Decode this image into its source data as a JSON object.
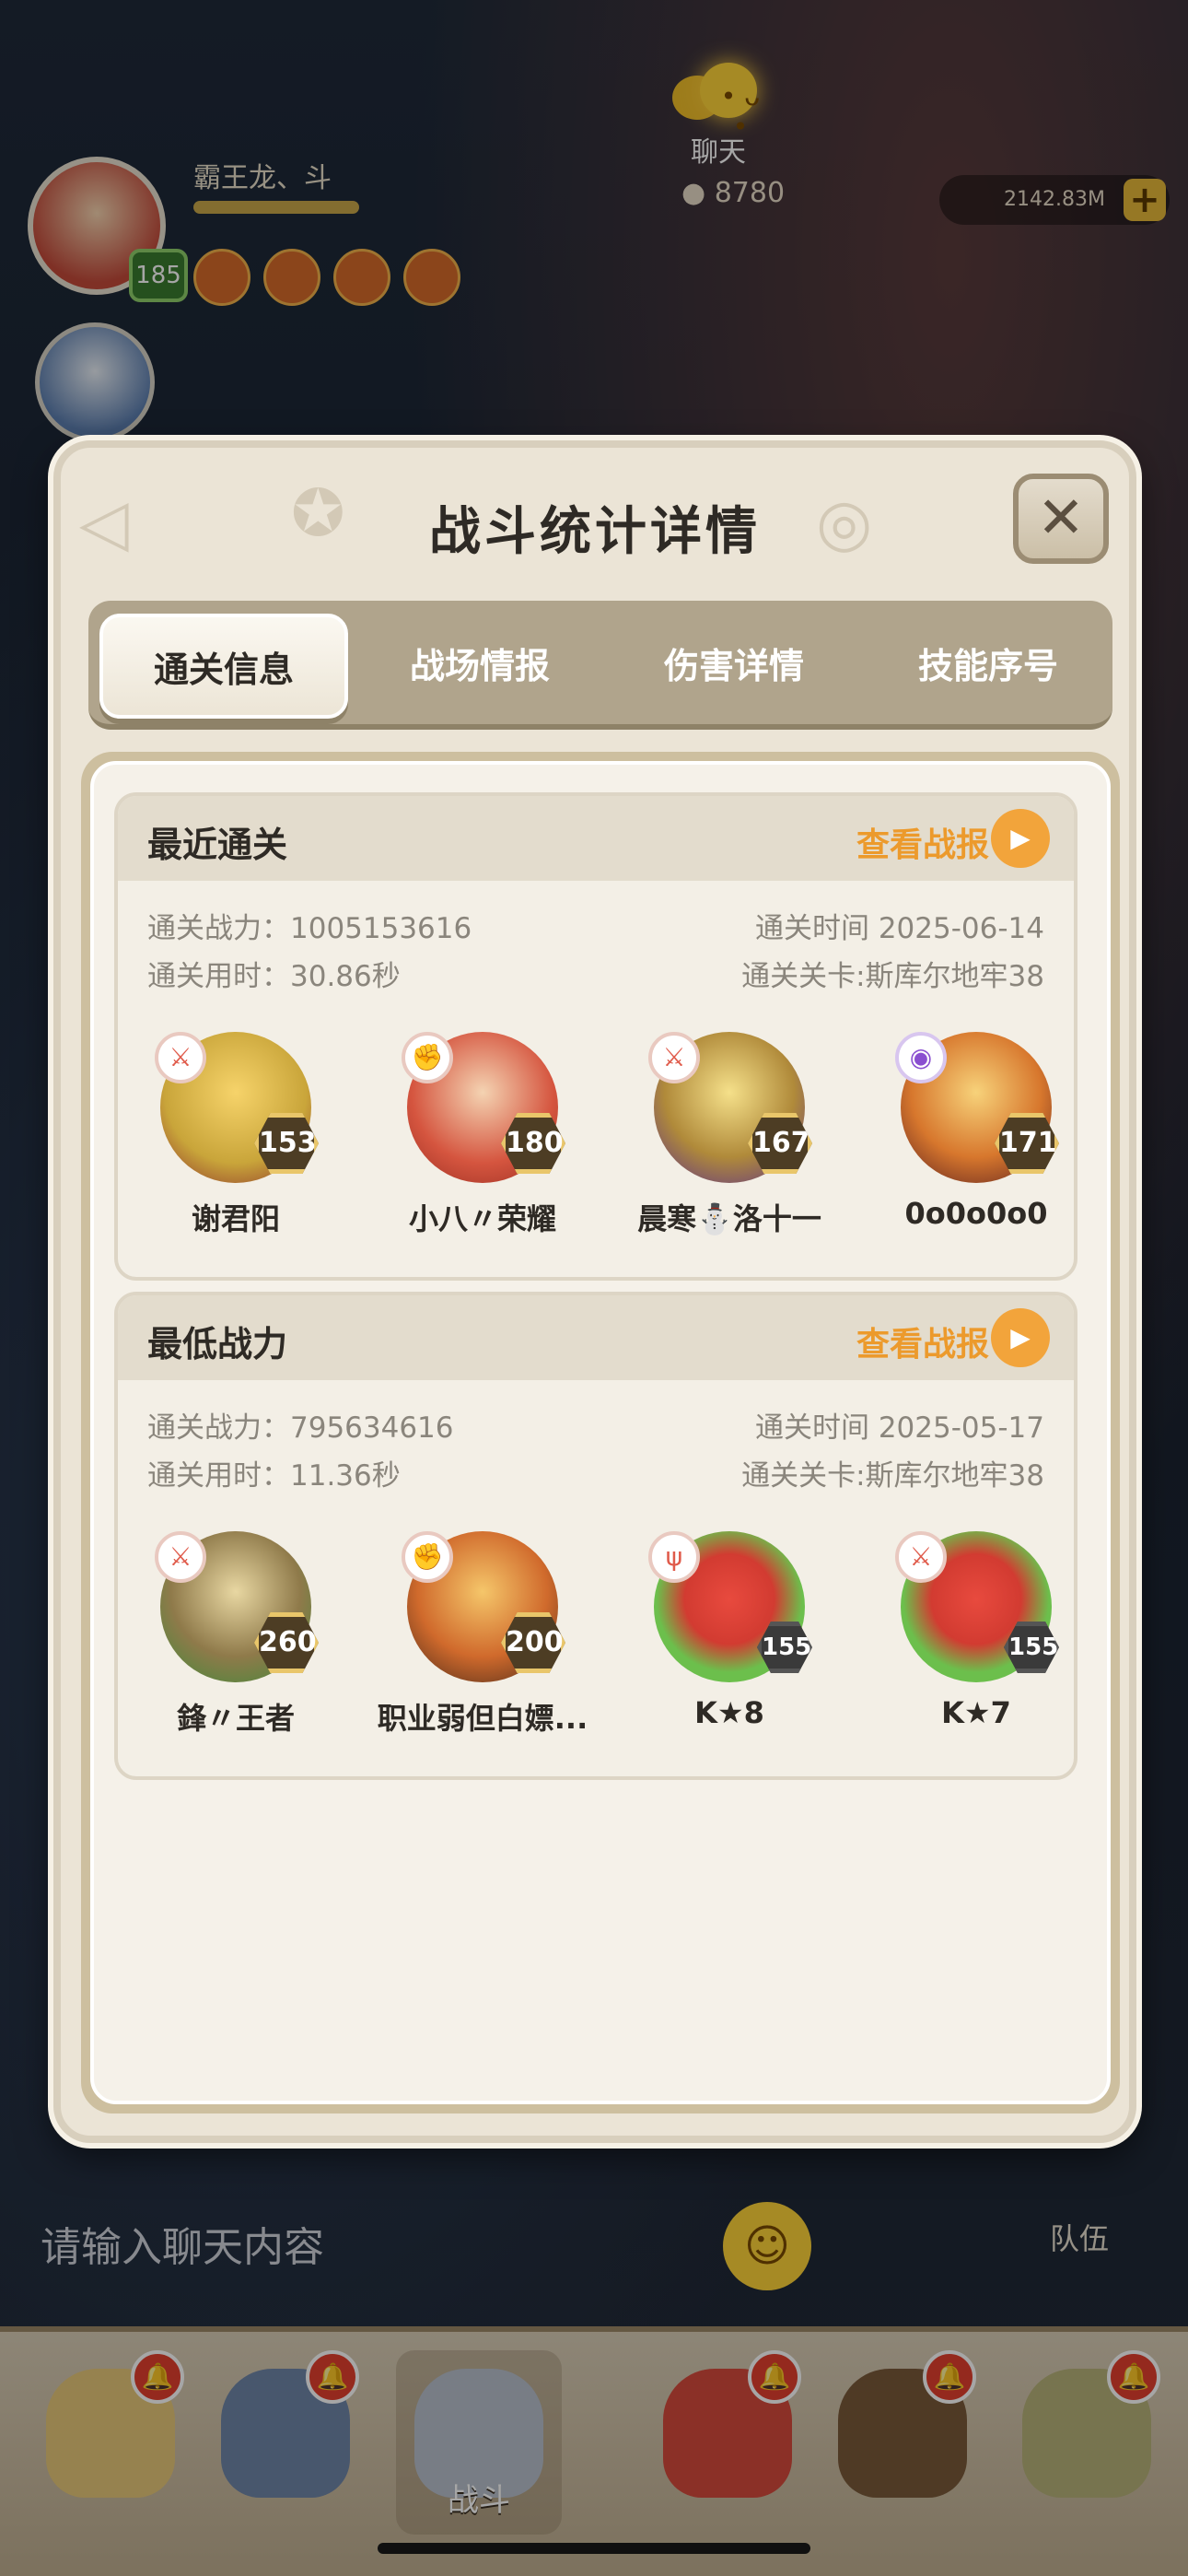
{
  "background": {
    "chat_label": "聊天",
    "player_name": "霸王龙、斗",
    "player_level": "185",
    "coins": "8780",
    "gems": "2142.83M",
    "chat_placeholder": "请输入聊天内容",
    "team_label": "队伍",
    "nav_active_label": "战斗"
  },
  "modal": {
    "title": "战斗统计详情",
    "close_icon": "close-icon",
    "tabs": [
      {
        "label": "通关信息",
        "active": true
      },
      {
        "label": "战场情报",
        "active": false
      },
      {
        "label": "伤害详情",
        "active": false
      },
      {
        "label": "技能序号",
        "active": false
      }
    ],
    "sections": [
      {
        "title": "最近通关",
        "report_link": "查看战报",
        "power": "通关战力：1005153616",
        "time": "通关时间  2025-06-14",
        "duration": "通关用时：30.86秒",
        "stage": "通关关卡:斯库尔地牢38",
        "heroes": [
          {
            "name": "谢君阳",
            "level": "153",
            "badge_icon": "sword-icon",
            "color": "#c9a53a"
          },
          {
            "name": "小八〃荣耀",
            "level": "180",
            "badge_icon": "fist-icon",
            "color": "#d5553f"
          },
          {
            "name": "晨寒⛄洛十一",
            "level": "167",
            "badge_icon": "sword-icon",
            "color": "#7b3fa8"
          },
          {
            "name": "0o0o0o0",
            "level": "171",
            "badge_icon": "orb-icon",
            "color": "#b2462a"
          }
        ]
      },
      {
        "title": "最低战力",
        "report_link": "查看战报",
        "power": "通关战力：795634616",
        "time": "通关时间  2025-05-17",
        "duration": "通关用时：11.36秒",
        "stage": "通关关卡:斯库尔地牢38",
        "heroes": [
          {
            "name": "鋒〃王者",
            "level": "260",
            "badge_icon": "sword-icon",
            "color": "#4f9a3f"
          },
          {
            "name": "职业弱但白嫖...",
            "level": "200",
            "badge_icon": "fist-icon",
            "color": "#d06a2c"
          },
          {
            "name": "K★8",
            "level": "155",
            "badge_icon": "trident-icon",
            "color": "#6cbf4c"
          },
          {
            "name": "K★7",
            "level": "155",
            "badge_icon": "sword-icon",
            "color": "#6cbf4c"
          }
        ]
      }
    ]
  }
}
